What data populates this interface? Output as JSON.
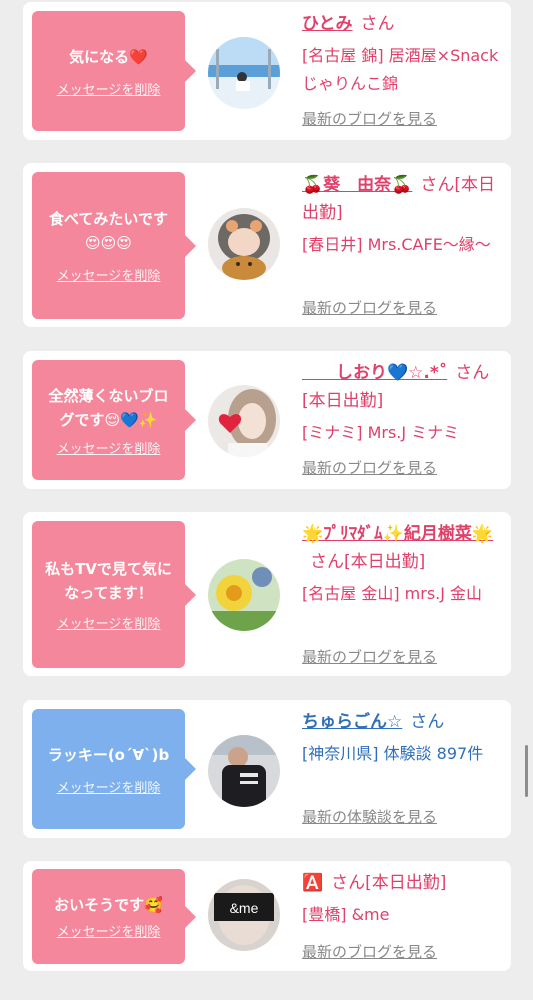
{
  "items": [
    {
      "message": "気になる❤️",
      "delete_label": "メッセージを削除",
      "name": "ひとみ",
      "suffix": "さん",
      "shop": "[名古屋 錦] 居酒屋×Snack じゃりんこ錦",
      "blog_link": "最新のブログを見る",
      "bubble_color": "#f4879b",
      "avatar": "beach-photo-icon"
    },
    {
      "message": "食べてみたいです😍😍😍",
      "delete_label": "メッセージを削除",
      "name": "🍒葵　由奈🍒",
      "suffix": "さん[本日出勤]",
      "shop": "[春日井] Mrs.CAFE〜縁〜",
      "blog_link": "最新のブログを見る",
      "bubble_color": "#f4879b",
      "avatar": "girl-with-food-photo-icon"
    },
    {
      "message": "全然薄くないブログです😌💙✨",
      "delete_label": "メッセージを削除",
      "name": "　　しおり💙☆.*˚",
      "suffix": "さん[本日出勤]",
      "shop": "[ミナミ] Mrs.J ミナミ",
      "blog_link": "最新のブログを見る",
      "bubble_color": "#f4879b",
      "avatar": "girl-with-heart-photo-icon"
    },
    {
      "message": "私もTVで見て気になってます！",
      "delete_label": "メッセージを削除",
      "name": "🌟ﾌﾟﾘﾏﾀﾞﾑ✨紀月樹菜🌟",
      "suffix": "さん[本日出勤]",
      "shop": "[名古屋 金山] mrs.J 金山",
      "blog_link": "最新のブログを見る",
      "bubble_color": "#f4879b",
      "avatar": "flower-photo-icon"
    },
    {
      "message": "ラッキー(o´∀`)b",
      "delete_label": "メッセージを削除",
      "name": "ちゅらごん☆",
      "suffix": "さん",
      "shop": "[神奈川県] 体験談 897件",
      "blog_link": "最新の体験談を見る",
      "bubble_color": "#7fb0ee",
      "avatar": "man-jacket-photo-icon"
    },
    {
      "message": "おいそうです🥰",
      "delete_label": "メッセージを削除",
      "name": "🅰️",
      "suffix": "さん[本日出勤]",
      "shop": "[豊橋] &me",
      "blog_link": "最新のブログを見る",
      "bubble_color": "#f4879b",
      "avatar": "me-logo-photo-icon"
    }
  ]
}
